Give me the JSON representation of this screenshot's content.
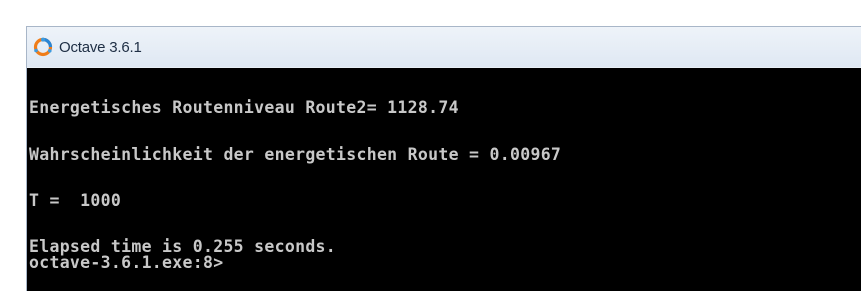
{
  "window": {
    "title": "Octave 3.6.1",
    "icon": "octave-logo-icon"
  },
  "console": {
    "lines": [
      "Energetisches Routenniveau Route2= 1128.74",
      "Wahrscheinlichkeit der energetischen Route = 0.00967",
      "T =  1000",
      "Elapsed time is 0.255 seconds.",
      "octave-3.6.1.exe:8>"
    ],
    "colors": {
      "background": "#000000",
      "text": "#c8c8c8"
    }
  }
}
